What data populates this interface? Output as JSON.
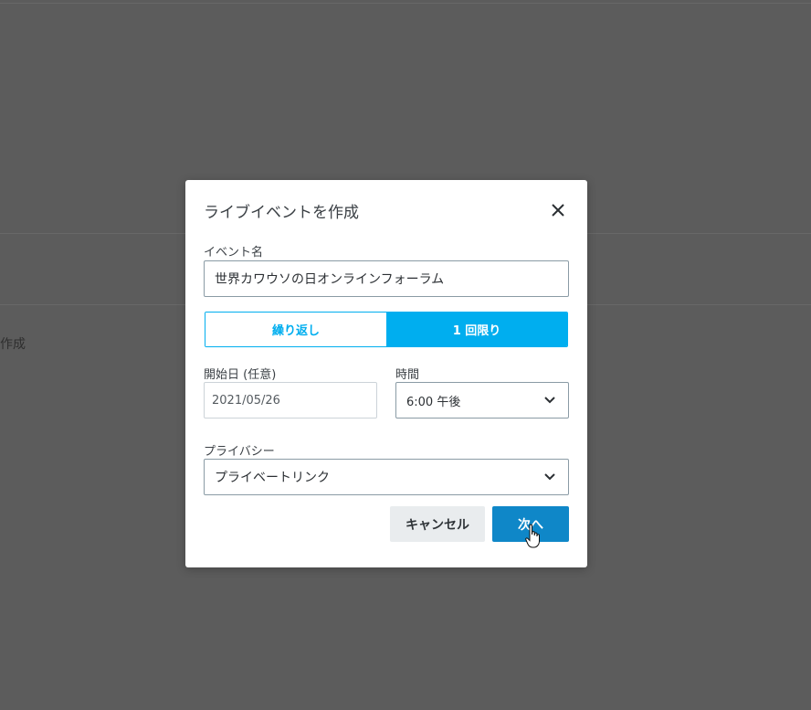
{
  "background": {
    "partial_text": "作成"
  },
  "modal": {
    "title": "ライブイベントを作成",
    "close_icon": "close-icon",
    "event_name": {
      "label": "イベント名",
      "value": "世界カワウソの日オンラインフォーラム"
    },
    "recurrence": {
      "options": [
        "繰り返し",
        "1 回限り"
      ],
      "selected": "1 回限り"
    },
    "start_date": {
      "label": "開始日 (任意)",
      "value": "2021/05/26"
    },
    "time": {
      "label": "時間",
      "value": "6:00 午後"
    },
    "privacy": {
      "label": "プライバシー",
      "value": "プライベートリンク"
    },
    "buttons": {
      "cancel": "キャンセル",
      "next": "次へ"
    }
  },
  "colors": {
    "accent": "#00aeef",
    "primary_button": "#0f87c8",
    "overlay": "#5c5c5c"
  }
}
